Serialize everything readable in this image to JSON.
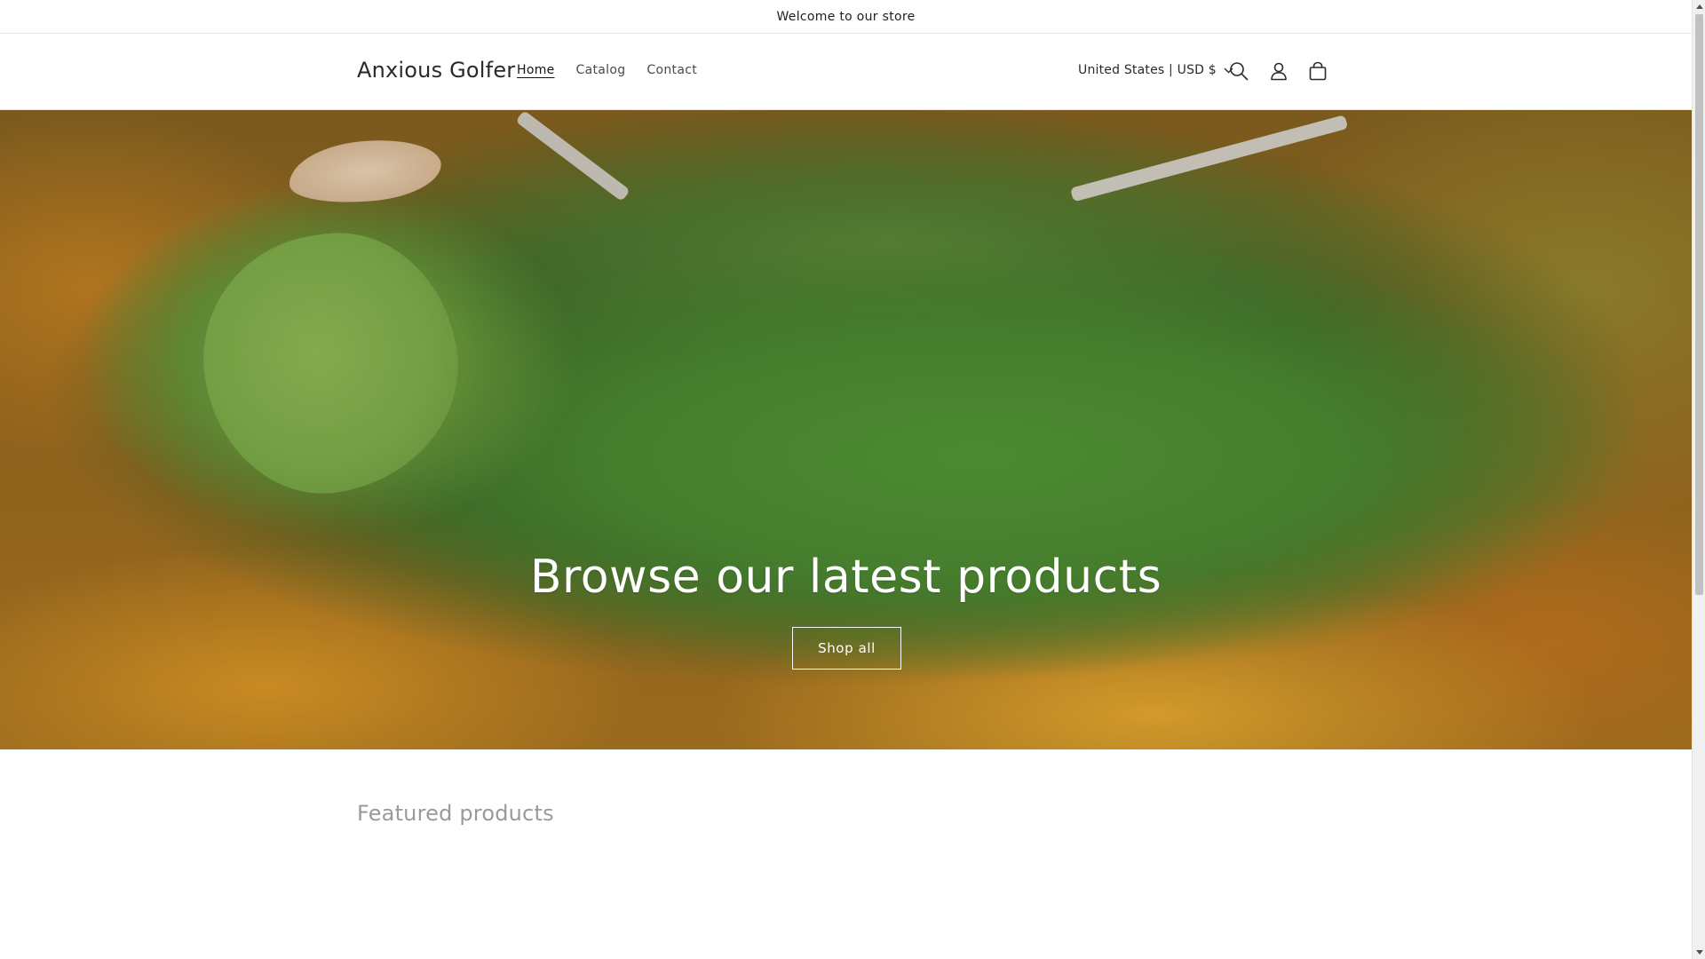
{
  "announcement": {
    "text": "Welcome to our store"
  },
  "header": {
    "logo": "Anxious Golfer",
    "nav": [
      {
        "label": "Home",
        "active": true
      },
      {
        "label": "Catalog",
        "active": false
      },
      {
        "label": "Contact",
        "active": false
      }
    ],
    "currency": "United States | USD $",
    "icons": [
      "search-icon",
      "account-icon",
      "cart-icon",
      "chevron-down-icon"
    ]
  },
  "hero": {
    "title": "Browse our latest products",
    "button_label": "Shop all"
  },
  "featured": {
    "title": "Featured products"
  },
  "colors": {
    "text": "#121212",
    "muted": "#9a9a9a",
    "border": "#e6e6e6",
    "hero_text": "#ffffff"
  }
}
